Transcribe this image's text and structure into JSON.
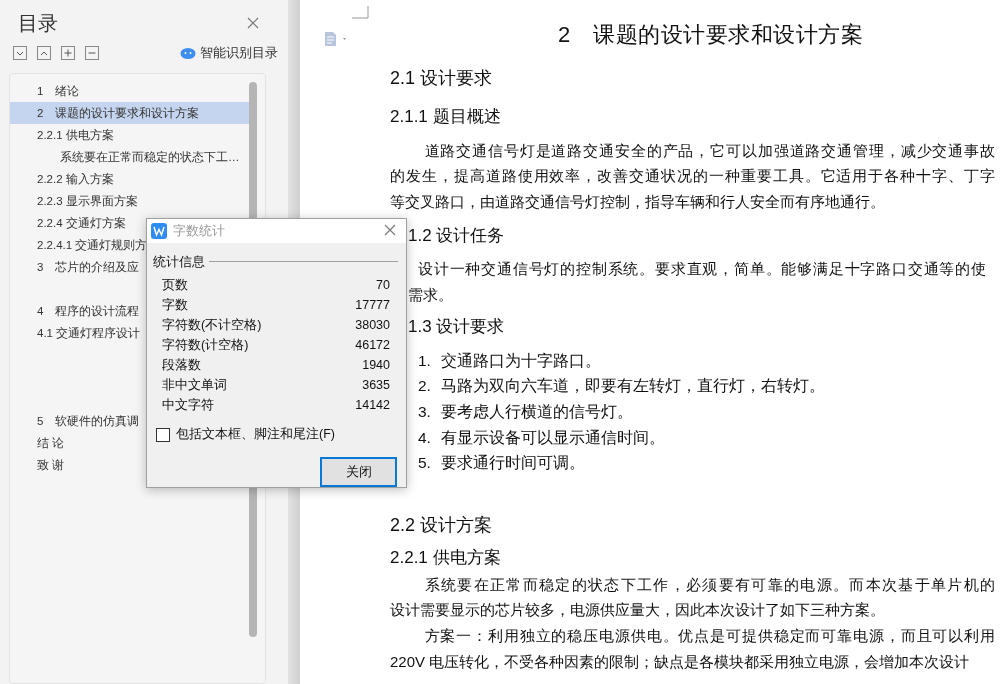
{
  "sidebar": {
    "title": "目录",
    "smart_toc": "智能识别目录",
    "items": [
      {
        "kind": "row",
        "text": "1　绪论",
        "selected": false
      },
      {
        "kind": "row",
        "text": "2　课题的设计要求和设计方案",
        "selected": true
      },
      {
        "kind": "row",
        "text": "2.2.1  供电方案",
        "selected": false,
        "children": [
          {
            "kind": "row",
            "text": "系统要在正常而稳定的状态下工…",
            "selected": false
          }
        ]
      },
      {
        "kind": "row",
        "text": "2.2.2  输入方案",
        "selected": false
      },
      {
        "kind": "row",
        "text": "2.2.3  显示界面方案",
        "selected": false
      },
      {
        "kind": "row",
        "text": "2.2.4 交通灯方案",
        "selected": false
      },
      {
        "kind": "row",
        "text": "2.2.4.1 交通灯规则方",
        "selected": false
      },
      {
        "kind": "row",
        "text": "3　芯片的介绍及应",
        "selected": false
      },
      {
        "kind": "after_gap",
        "text": "4　程序的设计流程",
        "selected": false
      },
      {
        "kind": "row",
        "text": "4.1  交通灯程序设计",
        "selected": false
      },
      {
        "kind": "after_wide_gap",
        "text": "5　软硬件的仿真调",
        "selected": false
      },
      {
        "kind": "row",
        "text": "结 论",
        "selected": false
      },
      {
        "kind": "row",
        "text": "致 谢",
        "selected": false
      }
    ]
  },
  "dialog": {
    "title": "字数统计",
    "group": "统计信息",
    "stats": [
      {
        "label": "页数",
        "value": "70"
      },
      {
        "label": "字数",
        "value": "17777"
      },
      {
        "label": "字符数(不计空格)",
        "value": "38030"
      },
      {
        "label": "字符数(计空格)",
        "value": "46172"
      },
      {
        "label": "段落数",
        "value": "1940"
      },
      {
        "label": "非中文单词",
        "value": "3635"
      },
      {
        "label": "中文字符",
        "value": "14142"
      }
    ],
    "checkbox": {
      "label": "包括文本框、脚注和尾注(F)",
      "checked": false
    },
    "button": "关闭"
  },
  "document": {
    "sections": [
      {
        "blocks": [
          {
            "kind": "title",
            "text": "2　课题的设计要求和设计方案"
          },
          {
            "kind": "h2",
            "text": "2.1 设计要求"
          },
          {
            "kind": "h3",
            "text": "2.1.1 题目概述"
          },
          {
            "kind": "para",
            "lines": [
              "道路交通信号灯是道路交通安全的产品，它可以加强道路交通管理，减少交通事故",
              "的发生，提高道路使用效率，改善交通状况的一种重要工具。它适用于各种十字、丁字",
              "等交叉路口，由道路交通信号灯控制，指导车辆和行人安全而有序地通行。"
            ]
          }
        ]
      },
      {
        "blocks": [
          {
            "kind": "h3",
            "text": "1.2 设计任务"
          },
          {
            "kind": "line",
            "text": "设计一种交通信号灯的控制系统。要求直观，简单。能够满足十字路口交通等的使"
          },
          {
            "kind": "line",
            "text": "需求。"
          },
          {
            "kind": "h3",
            "text": "1.3 设计要求"
          },
          {
            "kind": "item",
            "number": "1.",
            "text": "交通路口为十字路口。"
          },
          {
            "kind": "item",
            "number": "2.",
            "text": "马路为双向六车道，即要有左转灯，直行灯，右转灯。"
          },
          {
            "kind": "item",
            "number": "3.",
            "text": "要考虑人行横道的信号灯。"
          },
          {
            "kind": "item",
            "number": "4.",
            "text": "有显示设备可以显示通信时间。"
          },
          {
            "kind": "item",
            "number": "5.",
            "text": "要求通行时间可调。"
          }
        ]
      },
      {
        "blocks": [
          {
            "kind": "h2",
            "text": "2.2 设计方案"
          },
          {
            "kind": "h3",
            "text": "2.2.1 供电方案"
          },
          {
            "kind": "para",
            "lines": [
              "系统要在正常而稳定的状态下工作，必须要有可靠的电源。而本次基于单片机的",
              "设计需要显示的芯片较多，电源供应量大，因此本次设计了如下三种方案。"
            ]
          },
          {
            "kind": "para",
            "lines": [
              "方案一：利用独立的稳压电源供电。优点是可提供稳定而可靠电源，而且可以利用",
              "220V 电压转化，不受各种因素的限制；缺点是各模块都采用独立电源，会增加本次设计"
            ]
          }
        ]
      }
    ]
  }
}
